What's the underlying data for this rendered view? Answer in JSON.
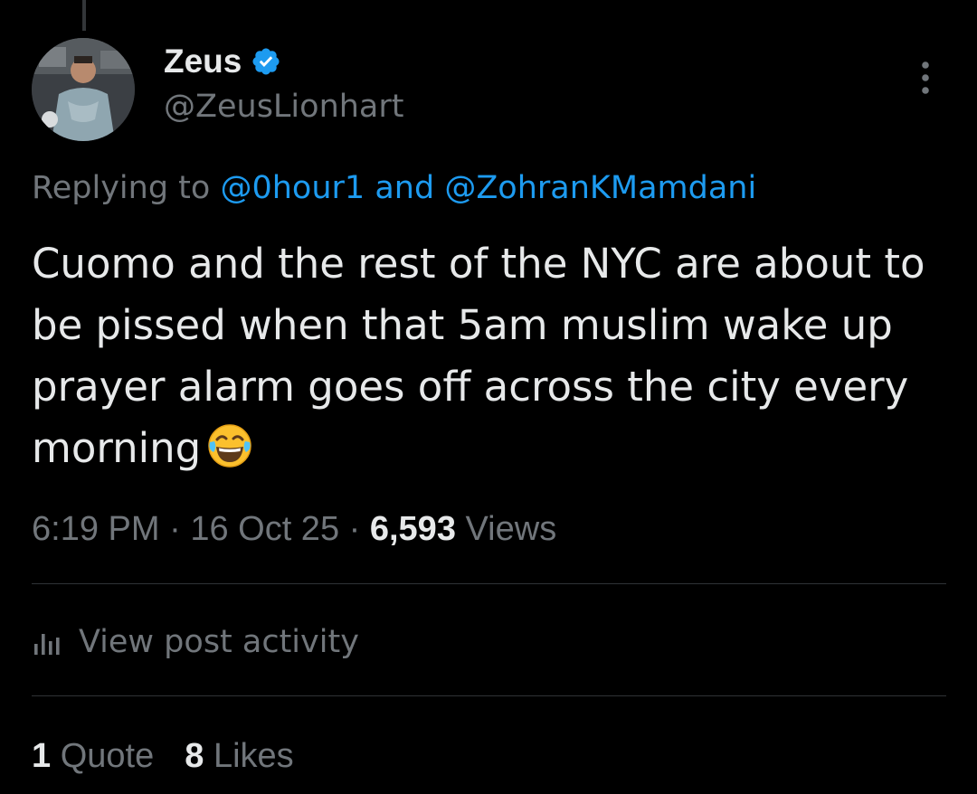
{
  "author": {
    "display_name": "Zeus",
    "handle": "@ZeusLionhart",
    "verified": true
  },
  "reply_context": {
    "prefix": "Replying to",
    "mention_1": "@0hour1",
    "joiner": "and",
    "mention_2": "@ZohranKMamdani"
  },
  "tweet": {
    "text": "Cuomo and the rest of the NYC are about to be pissed when that 5am muslim wake up prayer alarm goes off across the city every morning",
    "emoji": "face-with-tears-of-joy-icon"
  },
  "meta": {
    "time": "6:19 PM",
    "separator": "·",
    "date": "16 Oct 25",
    "views_count": "6,593",
    "views_label": "Views"
  },
  "activity": {
    "label": "View post activity",
    "icon": "analytics-icon"
  },
  "stats": {
    "quotes_count": "1",
    "quotes_label": "Quote",
    "likes_count": "8",
    "likes_label": "Likes"
  },
  "colors": {
    "background": "#000000",
    "text_primary": "#e7e9ea",
    "text_secondary": "#71767b",
    "accent": "#1d9bf0",
    "divider": "#2f3336"
  }
}
